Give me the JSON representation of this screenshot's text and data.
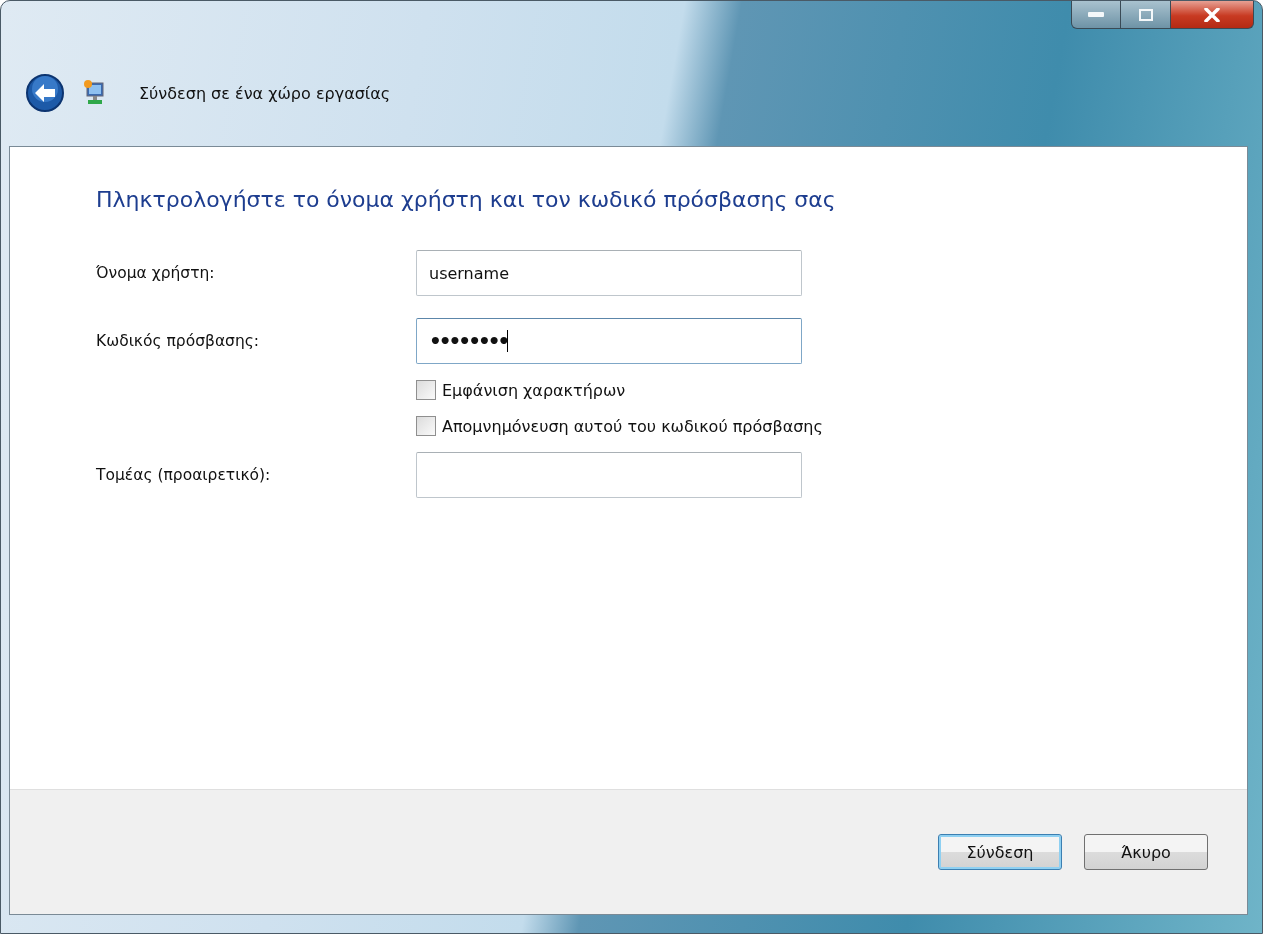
{
  "window": {
    "title": "Σύνδεση σε ένα χώρο εργασίας"
  },
  "heading": "Πληκτρολογήστε το όνομα χρήστη και τον κωδικό πρόσβασης σας",
  "fields": [
    {
      "kind": "text",
      "label": "Όνομα χρήστη:",
      "value": "username",
      "focused": false
    },
    {
      "kind": "password",
      "label": "Κωδικός πρόσβασης:",
      "value": "••••••••",
      "focused": true
    },
    {
      "kind": "checkbox",
      "label": "Εμφάνιση χαρακτήρων",
      "checked": false
    },
    {
      "kind": "checkbox",
      "label": "Απομνημόνευση αυτού του κωδικού πρόσβασης",
      "checked": false
    },
    {
      "kind": "text",
      "label": "Τομέας (προαιρετικό):",
      "focused": false
    }
  ],
  "buttons": [
    {
      "label": "Σύνδεση",
      "default": true
    },
    {
      "label": "Άκυρο",
      "default": false
    }
  ]
}
